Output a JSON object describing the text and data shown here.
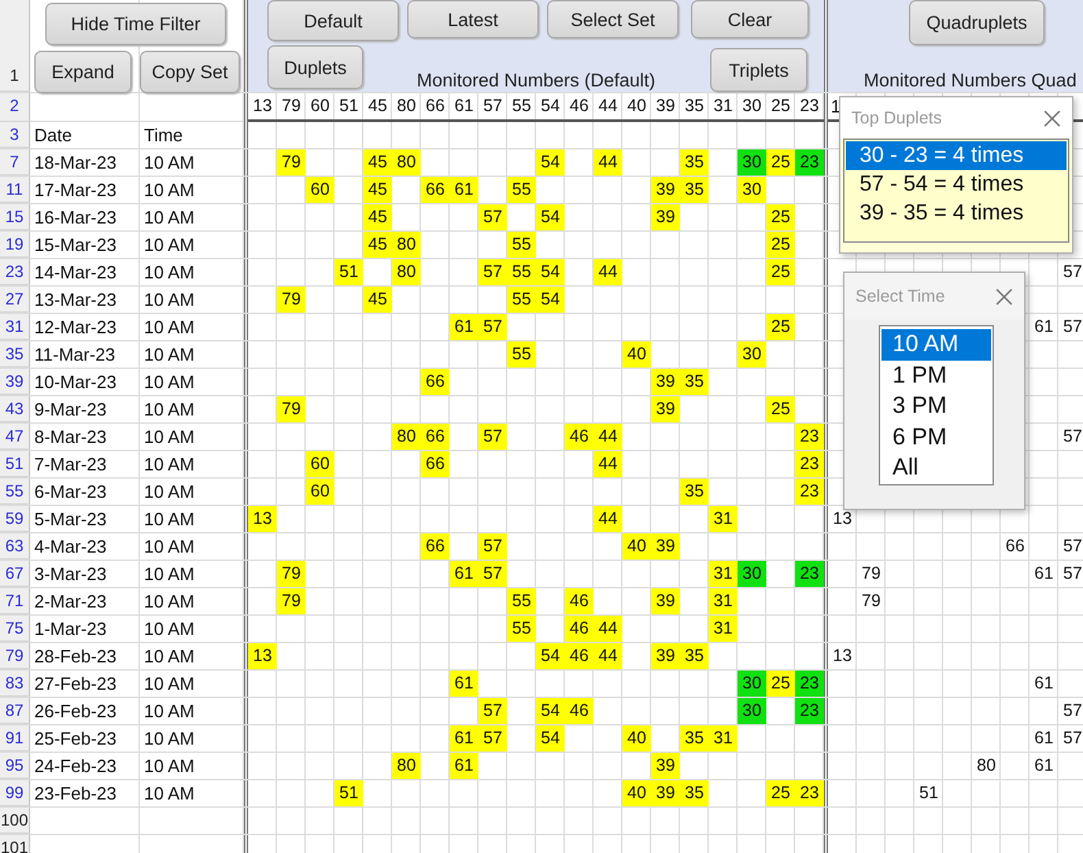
{
  "buttons": [
    "Hide Time Filter",
    "Default",
    "Latest",
    "Select Set",
    "Clear",
    "Quadruplets",
    "Expand",
    "Copy Set",
    "Duplets",
    "Triplets"
  ],
  "section_titles": [
    "Monitored Numbers (Default)",
    "Monitored Numbers Quad"
  ],
  "top_row": {
    "row_number": "1",
    "filtered": false
  },
  "number_header": {
    "row_number": "2",
    "filtered": true,
    "numbers": [
      "13",
      "79",
      "60",
      "51",
      "45",
      "80",
      "66",
      "61",
      "57",
      "55",
      "54",
      "46",
      "44",
      "40",
      "39",
      "35",
      "31",
      "30",
      "25",
      "23"
    ],
    "right_numbers": [
      "1"
    ]
  },
  "label_row": {
    "row_number": "3",
    "filtered": true,
    "date": "Date",
    "time": "Time"
  },
  "rows": [
    {
      "row_number": "7",
      "filtered": true,
      "date": "18-Mar-23",
      "time": "10 AM",
      "cells": [
        null,
        {
          "value": "79",
          "color": "#ffff00"
        },
        null,
        null,
        {
          "value": "45",
          "color": "#ffff00"
        },
        {
          "value": "80",
          "color": "#ffff00"
        },
        null,
        null,
        null,
        null,
        {
          "value": "54",
          "color": "#ffff00"
        },
        null,
        {
          "value": "44",
          "color": "#ffff00"
        },
        null,
        null,
        {
          "value": "35",
          "color": "#ffff00"
        },
        null,
        {
          "value": "30",
          "color": "#11e011"
        },
        {
          "value": "25",
          "color": "#ffff00"
        },
        {
          "value": "23",
          "color": "#11e011"
        }
      ],
      "right_cells": [
        null,
        null,
        null,
        null,
        null,
        null,
        null,
        null,
        null
      ]
    },
    {
      "row_number": "11",
      "filtered": true,
      "date": "17-Mar-23",
      "time": "10 AM",
      "cells": [
        null,
        null,
        {
          "value": "60",
          "color": "#ffff00"
        },
        null,
        {
          "value": "45",
          "color": "#ffff00"
        },
        null,
        {
          "value": "66",
          "color": "#ffff00"
        },
        {
          "value": "61",
          "color": "#ffff00"
        },
        null,
        {
          "value": "55",
          "color": "#ffff00"
        },
        null,
        null,
        null,
        null,
        {
          "value": "39",
          "color": "#ffff00"
        },
        {
          "value": "35",
          "color": "#ffff00"
        },
        null,
        {
          "value": "30",
          "color": "#ffff00"
        },
        null,
        null
      ],
      "right_cells": [
        null,
        null,
        null,
        null,
        null,
        null,
        null,
        null,
        null
      ]
    },
    {
      "row_number": "15",
      "filtered": true,
      "date": "16-Mar-23",
      "time": "10 AM",
      "cells": [
        null,
        null,
        null,
        null,
        {
          "value": "45",
          "color": "#ffff00"
        },
        null,
        null,
        null,
        {
          "value": "57",
          "color": "#ffff00"
        },
        null,
        {
          "value": "54",
          "color": "#ffff00"
        },
        null,
        null,
        null,
        {
          "value": "39",
          "color": "#ffff00"
        },
        null,
        null,
        null,
        {
          "value": "25",
          "color": "#ffff00"
        },
        null
      ],
      "right_cells": [
        null,
        null,
        null,
        null,
        null,
        null,
        null,
        null,
        null
      ]
    },
    {
      "row_number": "19",
      "filtered": true,
      "date": "15-Mar-23",
      "time": "10 AM",
      "cells": [
        null,
        null,
        null,
        null,
        {
          "value": "45",
          "color": "#ffff00"
        },
        {
          "value": "80",
          "color": "#ffff00"
        },
        null,
        null,
        null,
        {
          "value": "55",
          "color": "#ffff00"
        },
        null,
        null,
        null,
        null,
        null,
        null,
        null,
        null,
        {
          "value": "25",
          "color": "#ffff00"
        },
        null
      ],
      "right_cells": [
        null,
        null,
        null,
        null,
        null,
        null,
        null,
        null,
        null
      ]
    },
    {
      "row_number": "23",
      "filtered": true,
      "date": "14-Mar-23",
      "time": "10 AM",
      "cells": [
        null,
        null,
        null,
        {
          "value": "51",
          "color": "#ffff00"
        },
        null,
        {
          "value": "80",
          "color": "#ffff00"
        },
        null,
        null,
        {
          "value": "57",
          "color": "#ffff00"
        },
        {
          "value": "55",
          "color": "#ffff00"
        },
        {
          "value": "54",
          "color": "#ffff00"
        },
        null,
        {
          "value": "44",
          "color": "#ffff00"
        },
        null,
        null,
        null,
        null,
        null,
        {
          "value": "25",
          "color": "#ffff00"
        },
        null
      ],
      "right_cells": [
        null,
        null,
        null,
        null,
        null,
        null,
        null,
        null,
        "57"
      ]
    },
    {
      "row_number": "27",
      "filtered": true,
      "date": "13-Mar-23",
      "time": "10 AM",
      "cells": [
        null,
        {
          "value": "79",
          "color": "#ffff00"
        },
        null,
        null,
        {
          "value": "45",
          "color": "#ffff00"
        },
        null,
        null,
        null,
        null,
        {
          "value": "55",
          "color": "#ffff00"
        },
        {
          "value": "54",
          "color": "#ffff00"
        },
        null,
        null,
        null,
        null,
        null,
        null,
        null,
        null,
        null
      ],
      "right_cells": [
        null,
        null,
        null,
        null,
        null,
        null,
        null,
        null,
        null
      ]
    },
    {
      "row_number": "31",
      "filtered": true,
      "date": "12-Mar-23",
      "time": "10 AM",
      "cells": [
        null,
        null,
        null,
        null,
        null,
        null,
        null,
        {
          "value": "61",
          "color": "#ffff00"
        },
        {
          "value": "57",
          "color": "#ffff00"
        },
        null,
        null,
        null,
        null,
        null,
        null,
        null,
        null,
        null,
        {
          "value": "25",
          "color": "#ffff00"
        },
        null
      ],
      "right_cells": [
        null,
        null,
        null,
        null,
        null,
        null,
        null,
        "61",
        "57"
      ]
    },
    {
      "row_number": "35",
      "filtered": true,
      "date": "11-Mar-23",
      "time": "10 AM",
      "cells": [
        null,
        null,
        null,
        null,
        null,
        null,
        null,
        null,
        null,
        {
          "value": "55",
          "color": "#ffff00"
        },
        null,
        null,
        null,
        {
          "value": "40",
          "color": "#ffff00"
        },
        null,
        null,
        null,
        {
          "value": "30",
          "color": "#ffff00"
        },
        null,
        null
      ],
      "right_cells": [
        null,
        null,
        null,
        null,
        null,
        null,
        null,
        null,
        null
      ]
    },
    {
      "row_number": "39",
      "filtered": true,
      "date": "10-Mar-23",
      "time": "10 AM",
      "cells": [
        null,
        null,
        null,
        null,
        null,
        null,
        {
          "value": "66",
          "color": "#ffff00"
        },
        null,
        null,
        null,
        null,
        null,
        null,
        null,
        {
          "value": "39",
          "color": "#ffff00"
        },
        {
          "value": "35",
          "color": "#ffff00"
        },
        null,
        null,
        null,
        null
      ],
      "right_cells": [
        null,
        null,
        null,
        null,
        null,
        null,
        null,
        null,
        null
      ]
    },
    {
      "row_number": "43",
      "filtered": true,
      "date": "9-Mar-23",
      "time": "10 AM",
      "cells": [
        null,
        {
          "value": "79",
          "color": "#ffff00"
        },
        null,
        null,
        null,
        null,
        null,
        null,
        null,
        null,
        null,
        null,
        null,
        null,
        {
          "value": "39",
          "color": "#ffff00"
        },
        null,
        null,
        null,
        {
          "value": "25",
          "color": "#ffff00"
        },
        null
      ],
      "right_cells": [
        null,
        null,
        null,
        null,
        null,
        null,
        null,
        null,
        null
      ]
    },
    {
      "row_number": "47",
      "filtered": true,
      "date": "8-Mar-23",
      "time": "10 AM",
      "cells": [
        null,
        null,
        null,
        null,
        null,
        {
          "value": "80",
          "color": "#ffff00"
        },
        {
          "value": "66",
          "color": "#ffff00"
        },
        null,
        {
          "value": "57",
          "color": "#ffff00"
        },
        null,
        null,
        {
          "value": "46",
          "color": "#ffff00"
        },
        {
          "value": "44",
          "color": "#ffff00"
        },
        null,
        null,
        null,
        null,
        null,
        null,
        {
          "value": "23",
          "color": "#ffff00"
        }
      ],
      "right_cells": [
        null,
        null,
        null,
        null,
        null,
        null,
        null,
        null,
        "57"
      ]
    },
    {
      "row_number": "51",
      "filtered": true,
      "date": "7-Mar-23",
      "time": "10 AM",
      "cells": [
        null,
        null,
        {
          "value": "60",
          "color": "#ffff00"
        },
        null,
        null,
        null,
        {
          "value": "66",
          "color": "#ffff00"
        },
        null,
        null,
        null,
        null,
        null,
        {
          "value": "44",
          "color": "#ffff00"
        },
        null,
        null,
        null,
        null,
        null,
        null,
        {
          "value": "23",
          "color": "#ffff00"
        }
      ],
      "right_cells": [
        null,
        null,
        null,
        null,
        null,
        null,
        null,
        null,
        null
      ]
    },
    {
      "row_number": "55",
      "filtered": true,
      "date": "6-Mar-23",
      "time": "10 AM",
      "cells": [
        null,
        null,
        {
          "value": "60",
          "color": "#ffff00"
        },
        null,
        null,
        null,
        null,
        null,
        null,
        null,
        null,
        null,
        null,
        null,
        null,
        {
          "value": "35",
          "color": "#ffff00"
        },
        null,
        null,
        null,
        {
          "value": "23",
          "color": "#ffff00"
        }
      ],
      "right_cells": [
        null,
        null,
        null,
        null,
        null,
        null,
        null,
        null,
        null
      ]
    },
    {
      "row_number": "59",
      "filtered": true,
      "date": "5-Mar-23",
      "time": "10 AM",
      "cells": [
        {
          "value": "13",
          "color": "#ffff00"
        },
        null,
        null,
        null,
        null,
        null,
        null,
        null,
        null,
        null,
        null,
        null,
        {
          "value": "44",
          "color": "#ffff00"
        },
        null,
        null,
        null,
        {
          "value": "31",
          "color": "#ffff00"
        },
        null,
        null,
        null
      ],
      "right_cells": [
        "13",
        null,
        null,
        null,
        null,
        null,
        null,
        null,
        null
      ]
    },
    {
      "row_number": "63",
      "filtered": true,
      "date": "4-Mar-23",
      "time": "10 AM",
      "cells": [
        null,
        null,
        null,
        null,
        null,
        null,
        {
          "value": "66",
          "color": "#ffff00"
        },
        null,
        {
          "value": "57",
          "color": "#ffff00"
        },
        null,
        null,
        null,
        null,
        {
          "value": "40",
          "color": "#ffff00"
        },
        {
          "value": "39",
          "color": "#ffff00"
        },
        null,
        null,
        null,
        null,
        null
      ],
      "right_cells": [
        null,
        null,
        null,
        null,
        null,
        null,
        "66",
        null,
        "57"
      ]
    },
    {
      "row_number": "67",
      "filtered": true,
      "date": "3-Mar-23",
      "time": "10 AM",
      "cells": [
        null,
        {
          "value": "79",
          "color": "#ffff00"
        },
        null,
        null,
        null,
        null,
        null,
        {
          "value": "61",
          "color": "#ffff00"
        },
        {
          "value": "57",
          "color": "#ffff00"
        },
        null,
        null,
        null,
        null,
        null,
        null,
        null,
        {
          "value": "31",
          "color": "#ffff00"
        },
        {
          "value": "30",
          "color": "#11e011"
        },
        null,
        {
          "value": "23",
          "color": "#11e011"
        }
      ],
      "right_cells": [
        null,
        "79",
        null,
        null,
        null,
        null,
        null,
        "61",
        "57"
      ]
    },
    {
      "row_number": "71",
      "filtered": true,
      "date": "2-Mar-23",
      "time": "10 AM",
      "cells": [
        null,
        {
          "value": "79",
          "color": "#ffff00"
        },
        null,
        null,
        null,
        null,
        null,
        null,
        null,
        {
          "value": "55",
          "color": "#ffff00"
        },
        null,
        {
          "value": "46",
          "color": "#ffff00"
        },
        null,
        null,
        {
          "value": "39",
          "color": "#ffff00"
        },
        null,
        {
          "value": "31",
          "color": "#ffff00"
        },
        null,
        null,
        null
      ],
      "right_cells": [
        null,
        "79",
        null,
        null,
        null,
        null,
        null,
        null,
        null
      ]
    },
    {
      "row_number": "75",
      "filtered": true,
      "date": "1-Mar-23",
      "time": "10 AM",
      "cells": [
        null,
        null,
        null,
        null,
        null,
        null,
        null,
        null,
        null,
        {
          "value": "55",
          "color": "#ffff00"
        },
        null,
        {
          "value": "46",
          "color": "#ffff00"
        },
        {
          "value": "44",
          "color": "#ffff00"
        },
        null,
        null,
        null,
        {
          "value": "31",
          "color": "#ffff00"
        },
        null,
        null,
        null
      ],
      "right_cells": [
        null,
        null,
        null,
        null,
        null,
        null,
        null,
        null,
        null
      ]
    },
    {
      "row_number": "79",
      "filtered": true,
      "date": "28-Feb-23",
      "time": "10 AM",
      "cells": [
        {
          "value": "13",
          "color": "#ffff00"
        },
        null,
        null,
        null,
        null,
        null,
        null,
        null,
        null,
        null,
        {
          "value": "54",
          "color": "#ffff00"
        },
        {
          "value": "46",
          "color": "#ffff00"
        },
        {
          "value": "44",
          "color": "#ffff00"
        },
        null,
        {
          "value": "39",
          "color": "#ffff00"
        },
        {
          "value": "35",
          "color": "#ffff00"
        },
        null,
        null,
        null,
        null
      ],
      "right_cells": [
        "13",
        null,
        null,
        null,
        null,
        null,
        null,
        null,
        null
      ]
    },
    {
      "row_number": "83",
      "filtered": true,
      "date": "27-Feb-23",
      "time": "10 AM",
      "cells": [
        null,
        null,
        null,
        null,
        null,
        null,
        null,
        {
          "value": "61",
          "color": "#ffff00"
        },
        null,
        null,
        null,
        null,
        null,
        null,
        null,
        null,
        null,
        {
          "value": "30",
          "color": "#11e011"
        },
        {
          "value": "25",
          "color": "#ffff00"
        },
        {
          "value": "23",
          "color": "#11e011"
        }
      ],
      "right_cells": [
        null,
        null,
        null,
        null,
        null,
        null,
        null,
        "61",
        null
      ]
    },
    {
      "row_number": "87",
      "filtered": true,
      "date": "26-Feb-23",
      "time": "10 AM",
      "cells": [
        null,
        null,
        null,
        null,
        null,
        null,
        null,
        null,
        {
          "value": "57",
          "color": "#ffff00"
        },
        null,
        {
          "value": "54",
          "color": "#ffff00"
        },
        {
          "value": "46",
          "color": "#ffff00"
        },
        null,
        null,
        null,
        null,
        null,
        {
          "value": "30",
          "color": "#11e011"
        },
        null,
        {
          "value": "23",
          "color": "#11e011"
        }
      ],
      "right_cells": [
        null,
        null,
        null,
        null,
        null,
        null,
        null,
        null,
        "57"
      ]
    },
    {
      "row_number": "91",
      "filtered": true,
      "date": "25-Feb-23",
      "time": "10 AM",
      "cells": [
        null,
        null,
        null,
        null,
        null,
        null,
        null,
        {
          "value": "61",
          "color": "#ffff00"
        },
        {
          "value": "57",
          "color": "#ffff00"
        },
        null,
        {
          "value": "54",
          "color": "#ffff00"
        },
        null,
        null,
        {
          "value": "40",
          "color": "#ffff00"
        },
        null,
        {
          "value": "35",
          "color": "#ffff00"
        },
        {
          "value": "31",
          "color": "#ffff00"
        },
        null,
        null,
        null
      ],
      "right_cells": [
        null,
        null,
        null,
        null,
        null,
        null,
        null,
        "61",
        "57"
      ]
    },
    {
      "row_number": "95",
      "filtered": true,
      "date": "24-Feb-23",
      "time": "10 AM",
      "cells": [
        null,
        null,
        null,
        null,
        null,
        {
          "value": "80",
          "color": "#ffff00"
        },
        null,
        {
          "value": "61",
          "color": "#ffff00"
        },
        null,
        null,
        null,
        null,
        null,
        null,
        {
          "value": "39",
          "color": "#ffff00"
        },
        null,
        null,
        null,
        null,
        null
      ],
      "right_cells": [
        null,
        null,
        null,
        null,
        null,
        "80",
        null,
        "61",
        null
      ]
    },
    {
      "row_number": "99",
      "filtered": true,
      "date": "23-Feb-23",
      "time": "10 AM",
      "cells": [
        null,
        null,
        null,
        {
          "value": "51",
          "color": "#ffff00"
        },
        null,
        null,
        null,
        null,
        null,
        null,
        null,
        null,
        null,
        {
          "value": "40",
          "color": "#ffff00"
        },
        {
          "value": "39",
          "color": "#ffff00"
        },
        {
          "value": "35",
          "color": "#ffff00"
        },
        null,
        null,
        {
          "value": "25",
          "color": "#ffff00"
        },
        {
          "value": "23",
          "color": "#ffff00"
        }
      ],
      "right_cells": [
        null,
        null,
        null,
        "51",
        null,
        null,
        null,
        null,
        null
      ]
    }
  ],
  "empty_rows": [
    {
      "row_number": "100",
      "filtered": false
    },
    {
      "row_number": "101",
      "filtered": false
    }
  ],
  "top_duplets": {
    "title": "Top Duplets",
    "items": [
      {
        "label": "30 - 23 = 4 times",
        "selected": true
      },
      {
        "label": "57 - 54 = 4 times",
        "selected": false
      },
      {
        "label": "39 - 35 = 4 times",
        "selected": false
      }
    ]
  },
  "select_time": {
    "title": "Select Time",
    "items": [
      {
        "label": "10 AM",
        "selected": true
      },
      {
        "label": "1 PM",
        "selected": false
      },
      {
        "label": "3 PM",
        "selected": false
      },
      {
        "label": "6 PM",
        "selected": false
      },
      {
        "label": "All",
        "selected": false
      }
    ]
  }
}
